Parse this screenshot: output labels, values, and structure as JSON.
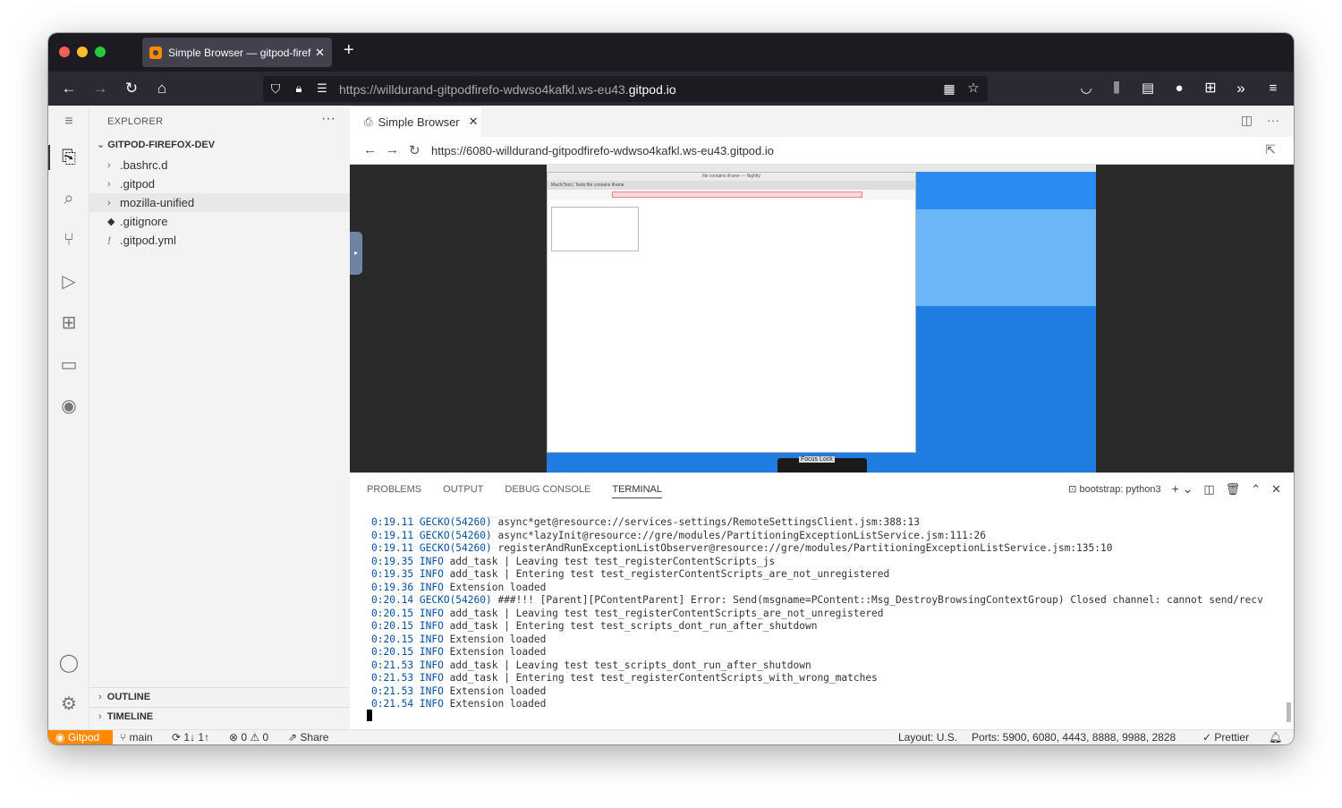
{
  "browser": {
    "tab_title": "Simple Browser — gitpod-firefox",
    "new_tab_label": "+",
    "url_prefix": "https://willdurand-gitpodfirefo-wdwso4kafkl.ws-eu43.",
    "url_domain": "gitpod.io"
  },
  "sidebar": {
    "title": "EXPLORER",
    "more": "···",
    "section": "GITPOD-FIREFOX-DEV",
    "items": [
      {
        "label": ".bashrc.d"
      },
      {
        "label": ".gitpod"
      },
      {
        "label": "mozilla-unified"
      },
      {
        "label": ".gitignore"
      },
      {
        "label": ".gitpod.yml"
      }
    ],
    "outline": "OUTLINE",
    "timeline": "TIMELINE"
  },
  "editor": {
    "tab_label": "Simple Browser",
    "simple_browser_url": "https://6080-willdurand-gitpodfirefo-wdwso4kafkl.ws-eu43.gitpod.io"
  },
  "vnc": {
    "window_title": "file contains iframe — Nightly",
    "tabs": "Mach/Test | Tests          file contains iframe",
    "dock_label": "Focus  Lock"
  },
  "panel": {
    "tabs": [
      "PROBLEMS",
      "OUTPUT",
      "DEBUG CONSOLE",
      "TERMINAL"
    ],
    "terminal_name": "bootstrap: python3"
  },
  "terminal": {
    "lines": [
      {
        "ts": "0:19.11",
        "lvl": "GECKO(54260)",
        "msg": "async*get@resource://services-settings/RemoteSettingsClient.jsm:388:13"
      },
      {
        "ts": "0:19.11",
        "lvl": "GECKO(54260)",
        "msg": "async*lazyInit@resource://gre/modules/PartitioningExceptionListService.jsm:111:26"
      },
      {
        "ts": "0:19.11",
        "lvl": "GECKO(54260)",
        "msg": "registerAndRunExceptionListObserver@resource://gre/modules/PartitioningExceptionListService.jsm:135:10"
      },
      {
        "ts": "0:19.35",
        "lvl": "INFO",
        "msg": "add_task | Leaving test test_registerContentScripts_js"
      },
      {
        "ts": "0:19.35",
        "lvl": "INFO",
        "msg": "add_task | Entering test test_registerContentScripts_are_not_unregistered"
      },
      {
        "ts": "0:19.36",
        "lvl": "INFO",
        "msg": "Extension loaded"
      },
      {
        "ts": "0:20.14",
        "lvl": "GECKO(54260)",
        "msg": "###!!! [Parent][PContentParent] Error: Send(msgname=PContent::Msg_DestroyBrowsingContextGroup) Closed channel: cannot send/recv"
      },
      {
        "ts": "0:20.15",
        "lvl": "INFO",
        "msg": "add_task | Leaving test test_registerContentScripts_are_not_unregistered"
      },
      {
        "ts": "0:20.15",
        "lvl": "INFO",
        "msg": "add_task | Entering test test_scripts_dont_run_after_shutdown"
      },
      {
        "ts": "0:20.15",
        "lvl": "INFO",
        "msg": "Extension loaded"
      },
      {
        "ts": "0:20.15",
        "lvl": "INFO",
        "msg": "Extension loaded"
      },
      {
        "ts": "0:21.53",
        "lvl": "INFO",
        "msg": "add_task | Leaving test test_scripts_dont_run_after_shutdown"
      },
      {
        "ts": "0:21.53",
        "lvl": "INFO",
        "msg": "add_task | Entering test test_registerContentScripts_with_wrong_matches"
      },
      {
        "ts": "0:21.53",
        "lvl": "INFO",
        "msg": "Extension loaded"
      },
      {
        "ts": "0:21.54",
        "lvl": "INFO",
        "msg": "Extension loaded"
      }
    ]
  },
  "statusbar": {
    "gitpod": "Gitpod",
    "branch": "main",
    "sync": "1↓ 1↑",
    "problems": "0",
    "warnings": "0",
    "share": "Share",
    "layout": "Layout: U.S.",
    "ports": "Ports: 5900, 6080, 4443, 8888, 9988, 2828",
    "prettier": "Prettier"
  },
  "colors": {
    "gitpod_orange": "#ff8a00",
    "firefox_dark": "#1c1b22"
  }
}
